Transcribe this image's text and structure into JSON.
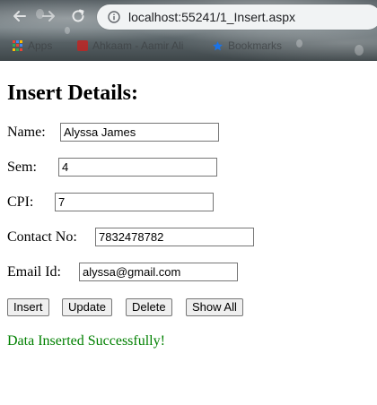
{
  "browser": {
    "url": "localhost:55241/1_Insert.aspx",
    "bookmarks": [
      {
        "label": "Apps",
        "icon": "apps-grid-icon"
      },
      {
        "label": "Ahkaam - Aamir Ali",
        "icon": "site-favicon-icon"
      },
      {
        "label": "Bookmarks",
        "icon": "star-icon"
      }
    ]
  },
  "page": {
    "heading": "Insert Details:",
    "form": {
      "name": {
        "label": "Name:",
        "value": "Alyssa James"
      },
      "sem": {
        "label": "Sem:",
        "value": "4"
      },
      "cpi": {
        "label": "CPI:",
        "value": "7"
      },
      "contact": {
        "label": "Contact No:",
        "value": "7832478782"
      },
      "email": {
        "label": "Email Id:",
        "value": "alyssa@gmail.com"
      }
    },
    "buttons": {
      "insert": "Insert",
      "update": "Update",
      "delete": "Delete",
      "show_all": "Show All"
    },
    "status_message": "Data Inserted Successfully!",
    "status_color": "#008000"
  }
}
